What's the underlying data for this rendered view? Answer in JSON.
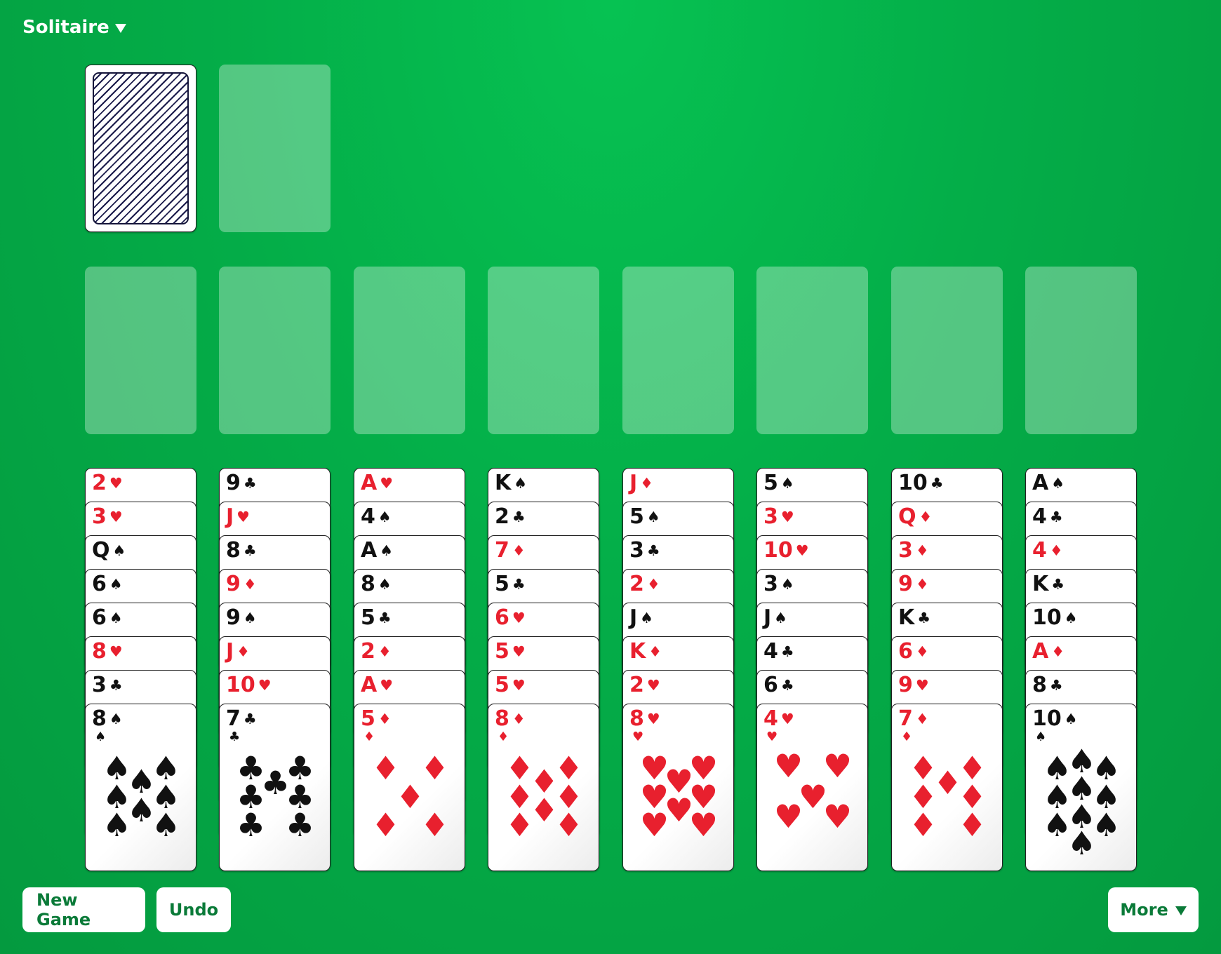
{
  "menu": {
    "label": "Solitaire"
  },
  "buttons": {
    "new_game": "New Game",
    "undo": "Undo",
    "more": "More"
  },
  "colors": {
    "felt": "#04ad48",
    "red": "#e8202e",
    "black": "#111111",
    "button_text": "#0a7a38"
  },
  "stock": {
    "face_down": true
  },
  "foundations_count": 8,
  "tableau": [
    [
      "2♥",
      "3♥",
      "Q♠",
      "6♠",
      "6♠",
      "8♥",
      "3♣",
      "8♠"
    ],
    [
      "9♣",
      "J♥",
      "8♣",
      "9♦",
      "9♠",
      "J♦",
      "10♥",
      "7♣"
    ],
    [
      "A♥",
      "4♠",
      "A♠",
      "8♠",
      "5♣",
      "2♦",
      "A♥",
      "5♦"
    ],
    [
      "K♠",
      "2♣",
      "7♦",
      "5♣",
      "6♥",
      "5♥",
      "5♥",
      "8♦"
    ],
    [
      "J♦",
      "5♠",
      "3♣",
      "2♦",
      "J♠",
      "K♦",
      "2♥",
      "8♥"
    ],
    [
      "5♠",
      "3♥",
      "10♥",
      "3♠",
      "J♠",
      "4♣",
      "6♣",
      "4♥"
    ],
    [
      "10♣",
      "Q♦",
      "3♦",
      "9♦",
      "K♣",
      "6♦",
      "9♥",
      "7♦"
    ],
    [
      "A♠",
      "4♣",
      "4♦",
      "K♣",
      "10♠",
      "A♦",
      "8♣",
      "10♠"
    ]
  ]
}
